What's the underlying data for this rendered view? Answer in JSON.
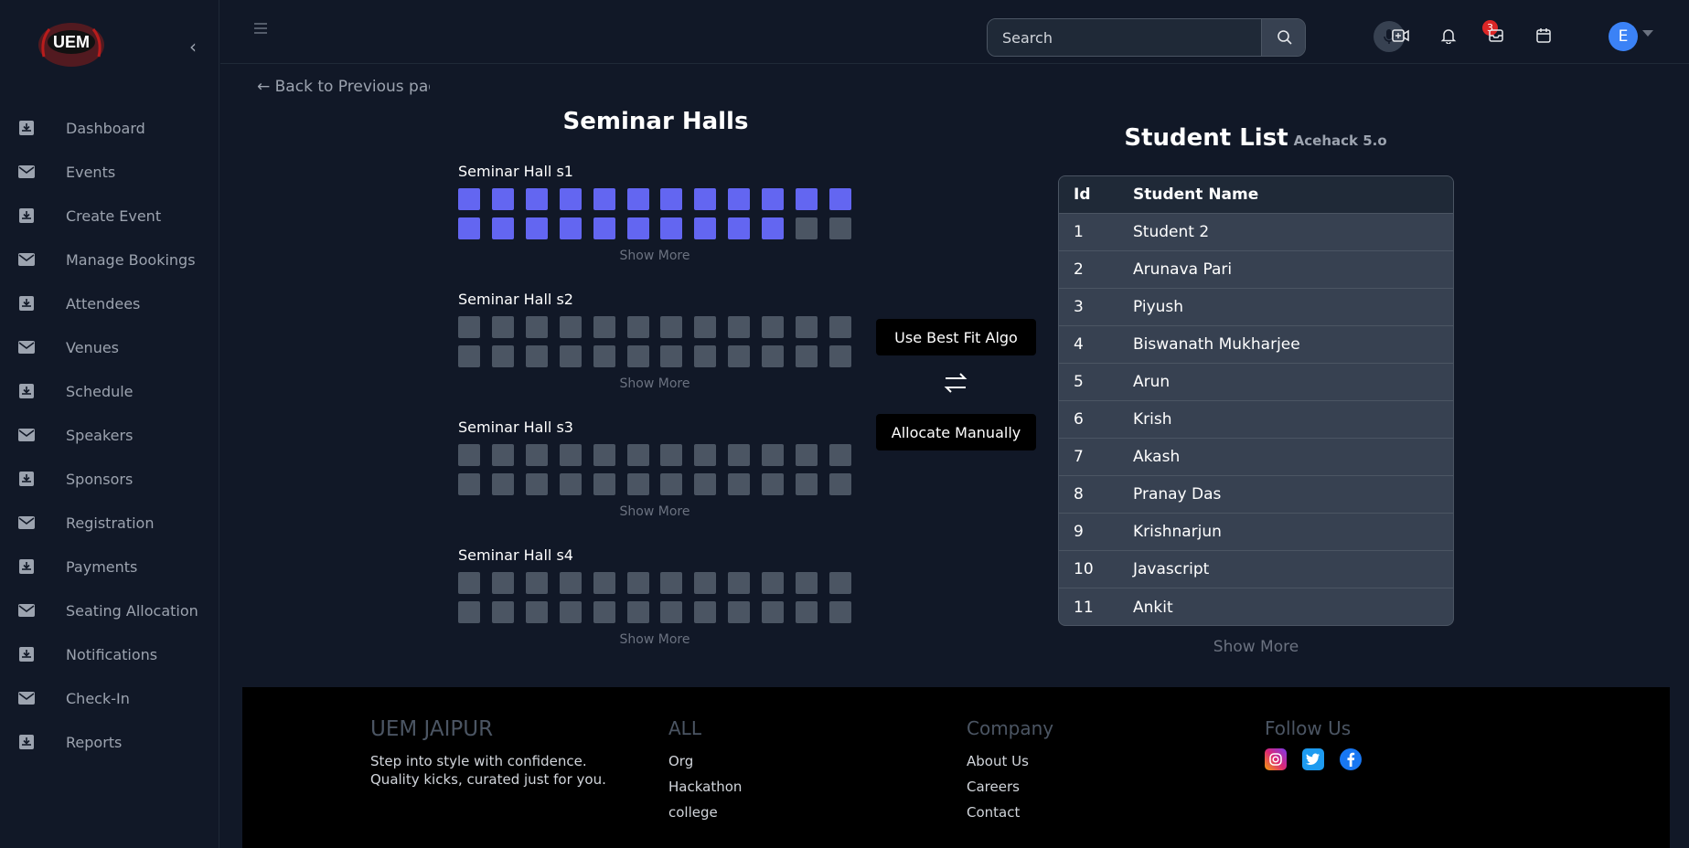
{
  "brand": {
    "logo_text": "UEM"
  },
  "sidebar": {
    "items": [
      {
        "label": "Dashboard",
        "icon": "inbox-download-icon"
      },
      {
        "label": "Events",
        "icon": "envelope-icon"
      },
      {
        "label": "Create Event",
        "icon": "inbox-download-icon"
      },
      {
        "label": "Manage Bookings",
        "icon": "envelope-icon"
      },
      {
        "label": "Attendees",
        "icon": "inbox-download-icon"
      },
      {
        "label": "Venues",
        "icon": "envelope-icon"
      },
      {
        "label": "Schedule",
        "icon": "inbox-download-icon"
      },
      {
        "label": "Speakers",
        "icon": "envelope-icon"
      },
      {
        "label": "Sponsors",
        "icon": "inbox-download-icon"
      },
      {
        "label": "Registration",
        "icon": "envelope-icon"
      },
      {
        "label": "Payments",
        "icon": "inbox-download-icon"
      },
      {
        "label": "Seating Allocation",
        "icon": "envelope-icon"
      },
      {
        "label": "Notifications",
        "icon": "inbox-download-icon"
      },
      {
        "label": "Check-In",
        "icon": "envelope-icon"
      },
      {
        "label": "Reports",
        "icon": "inbox-download-icon"
      }
    ]
  },
  "topbar": {
    "search_placeholder": "Search",
    "notification_count": "3",
    "avatar_initial": "E"
  },
  "main": {
    "back_label": "← Back to Previous page",
    "halls_title": "Seminar Halls",
    "show_more": "Show More",
    "halls": [
      {
        "name": "Seminar Hall s1",
        "seats_per_row": 12,
        "filled_row1": 12,
        "filled_row2": 10
      },
      {
        "name": "Seminar Hall s2",
        "seats_per_row": 12,
        "filled_row1": 0,
        "filled_row2": 0
      },
      {
        "name": "Seminar Hall s3",
        "seats_per_row": 12,
        "filled_row1": 0,
        "filled_row2": 0
      },
      {
        "name": "Seminar Hall s4",
        "seats_per_row": 12,
        "filled_row1": 0,
        "filled_row2": 0
      }
    ],
    "best_fit_label": "Use Best Fit Algo",
    "manual_label": "Allocate Manually",
    "student_title": "Student List",
    "student_subtitle": "Acehack 5.o",
    "columns": [
      "Id",
      "Student Name"
    ],
    "students": [
      {
        "id": "1",
        "name": "Student 2"
      },
      {
        "id": "2",
        "name": "Arunava Pari"
      },
      {
        "id": "3",
        "name": "Piyush"
      },
      {
        "id": "4",
        "name": "Biswanath Mukharjee"
      },
      {
        "id": "5",
        "name": "Arun"
      },
      {
        "id": "6",
        "name": "Krish"
      },
      {
        "id": "7",
        "name": "Akash"
      },
      {
        "id": "8",
        "name": "Pranay Das"
      },
      {
        "id": "9",
        "name": "Krishnarjun"
      },
      {
        "id": "10",
        "name": "Javascript"
      },
      {
        "id": "11",
        "name": "Ankit"
      }
    ],
    "table_show_more": "Show More"
  },
  "footer": {
    "brand": "UEM JAIPUR",
    "tagline": "Step into style with confidence. Quality kicks, curated just for you.",
    "col_all": {
      "title": "ALL",
      "links": [
        "Org",
        "Hackathon",
        "college"
      ]
    },
    "col_company": {
      "title": "Company",
      "links": [
        "About Us",
        "Careers",
        "Contact"
      ]
    },
    "col_follow": {
      "title": "Follow Us"
    }
  },
  "colors": {
    "seat_filled": "#6366f1",
    "seat_empty": "#4b5563",
    "accent": "#3b82f6"
  }
}
